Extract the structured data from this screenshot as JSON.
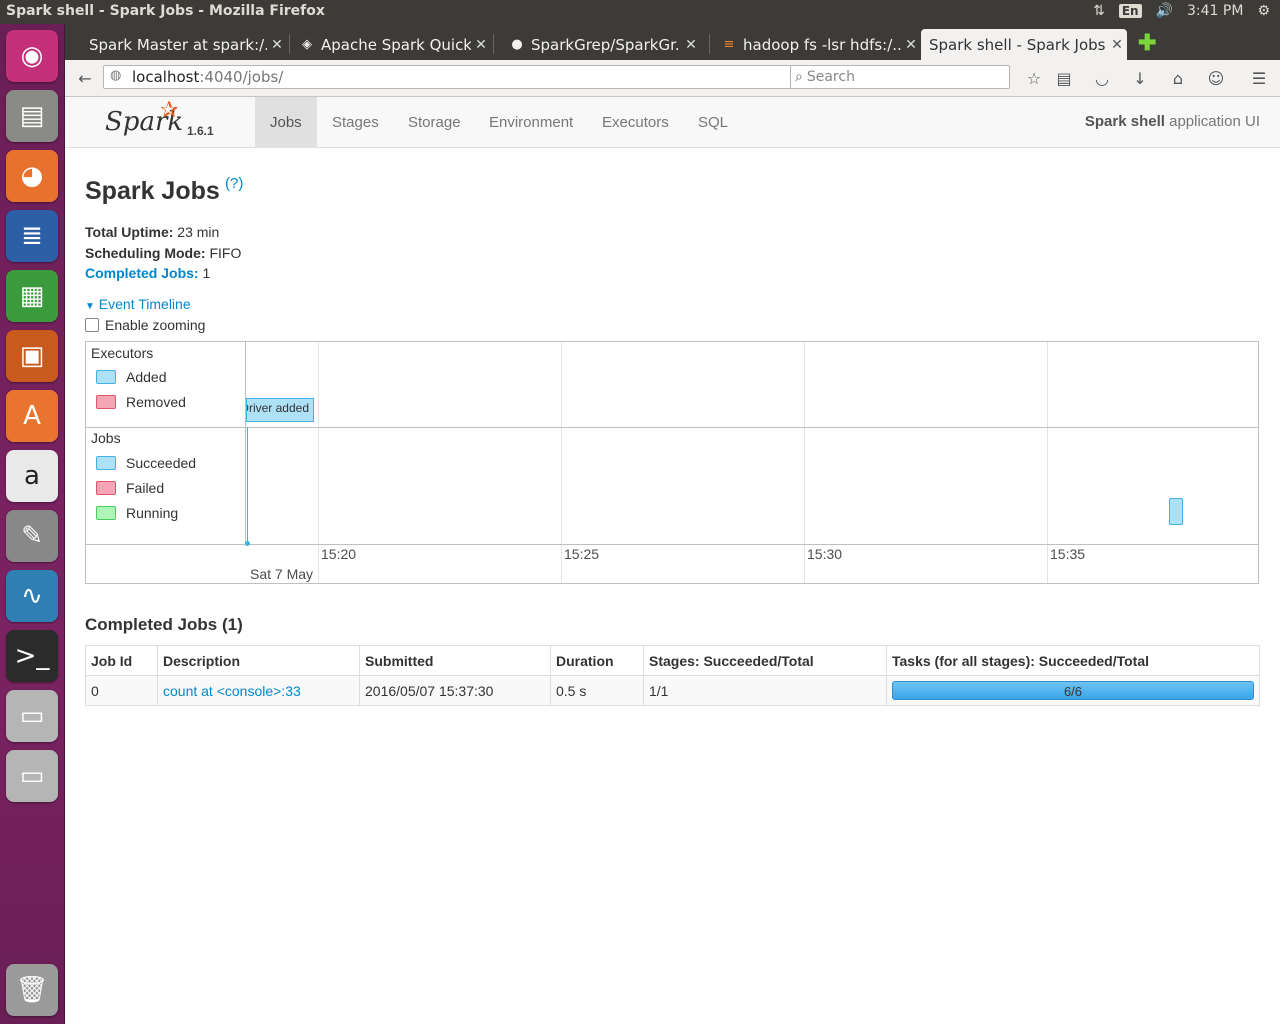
{
  "os": {
    "window_title": "Spark shell - Spark Jobs - Mozilla Firefox",
    "tray": {
      "kbd": "En",
      "time": "3:41 PM"
    }
  },
  "browser": {
    "tabs": [
      {
        "label": "Spark Master at spark:/...",
        "active": false
      },
      {
        "label": "Apache Spark Quick ...",
        "active": false
      },
      {
        "label": "SparkGrep/SparkGr...",
        "active": false
      },
      {
        "label": "hadoop fs -lsr hdfs:/...",
        "active": false
      },
      {
        "label": "Spark shell - Spark Jobs",
        "active": true
      }
    ],
    "url_host": "localhost",
    "url_path": ":4040/jobs/",
    "search_placeholder": "Search"
  },
  "spark": {
    "version": "1.6.1",
    "logo_text": "Spark",
    "nav": [
      "Jobs",
      "Stages",
      "Storage",
      "Environment",
      "Executors",
      "SQL"
    ],
    "active_nav": "Jobs",
    "app_name_bold": "Spark shell",
    "app_name_rest": " application UI"
  },
  "content": {
    "title": "Spark Jobs",
    "help": "(?)",
    "uptime_label": "Total Uptime:",
    "uptime_value": " 23 min",
    "mode_label": "Scheduling Mode:",
    "mode_value": " FIFO",
    "completed_label": "Completed Jobs:",
    "completed_value": " 1",
    "timeline_toggle": "Event Timeline",
    "enable_zoom": "Enable zooming"
  },
  "timeline": {
    "executors_title": "Executors",
    "executors_legend": [
      "Added",
      "Removed"
    ],
    "jobs_title": "Jobs",
    "jobs_legend": [
      "Succeeded",
      "Failed",
      "Running"
    ],
    "ticks": [
      "15:20",
      "15:25",
      "15:30",
      "15:35"
    ],
    "date_label": "Sat 7 May",
    "driver_event": "Driver added",
    "colors": {
      "added": "#aee0f6",
      "removed": "#f6a5b4",
      "running": "#aef5b8"
    }
  },
  "completed_jobs": {
    "title": "Completed Jobs (1)",
    "headers": [
      "Job Id",
      "Description",
      "Submitted",
      "Duration",
      "Stages: Succeeded/Total",
      "Tasks (for all stages): Succeeded/Total"
    ],
    "rows": [
      {
        "job_id": "0",
        "description": "count at <console>:33",
        "submitted": "2016/05/07 15:37:30",
        "duration": "0.5 s",
        "stages": "1/1",
        "tasks": "6/6",
        "tasks_fraction": 1.0
      }
    ]
  }
}
